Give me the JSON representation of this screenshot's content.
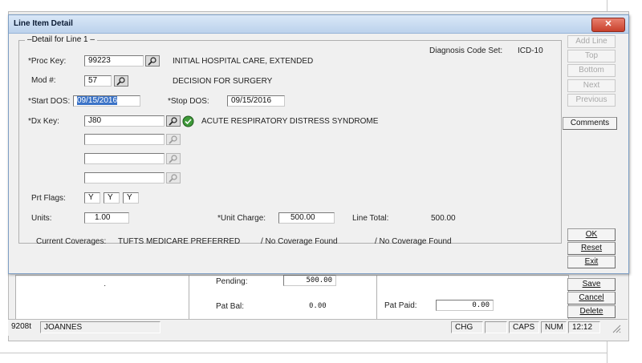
{
  "dialog": {
    "title": "Line Item Detail",
    "close_glyph": "✕",
    "group_label": "Detail for Line  1",
    "diagnosis_code_set_label": "Diagnosis Code Set:",
    "diagnosis_code_set_value": "ICD-10",
    "proc_key": {
      "label": "*Proc Key:",
      "value": "99223",
      "description": "INITIAL HOSPITAL CARE, EXTENDED"
    },
    "mod": {
      "label": "Mod #:",
      "value": "57",
      "description": "DECISION FOR SURGERY"
    },
    "start_dos": {
      "label": "*Start DOS:",
      "value": "09/15/2016"
    },
    "stop_dos": {
      "label": "*Stop DOS:",
      "value": "09/15/2016"
    },
    "dx_key": {
      "label": "*Dx Key:",
      "value": "J80",
      "description": "ACUTE RESPIRATORY DISTRESS SYNDROME"
    },
    "extra_dx": [
      "",
      "",
      ""
    ],
    "prt_flags": {
      "label": "Prt Flags:",
      "values": [
        "Y",
        "Y",
        "Y"
      ]
    },
    "units": {
      "label": "Units:",
      "value": "1.00"
    },
    "unit_charge": {
      "label": "*Unit Charge:",
      "value": "500.00"
    },
    "line_total": {
      "label": "Line Total:",
      "value": "500.00"
    },
    "coverages": {
      "label": "Current Coverages:",
      "items": [
        "TUFTS MEDICARE PREFERRED",
        "/ No Coverage Found",
        "/ No Coverage Found"
      ]
    },
    "side_buttons": {
      "add_line": "Add Line",
      "top": "Top",
      "bottom": "Bottom",
      "next": "Next",
      "previous": "Previous",
      "comments": "Comments"
    },
    "action_buttons": {
      "ok": "OK",
      "reset": "Reset",
      "exit": "Exit"
    }
  },
  "parent": {
    "pending": {
      "label": "Pending:",
      "value": "500.00"
    },
    "pat_bal": {
      "label": "Pat Bal:",
      "value": "0.00"
    },
    "pat_paid": {
      "label": "Pat Paid:",
      "value": "0.00"
    },
    "buttons": {
      "save": "Save",
      "cancel": "Cancel",
      "delete": "Delete"
    },
    "dot": "·"
  },
  "statusbar": {
    "code": "9208t",
    "user": "JOANNES",
    "mode": "CHG",
    "caps": "CAPS",
    "num": "NUM",
    "time": "12:12"
  }
}
